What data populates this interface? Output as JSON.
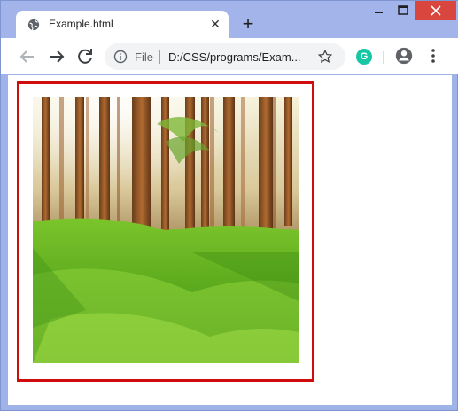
{
  "browser": {
    "tab": {
      "title": "Example.html",
      "favicon_icon": "globe-icon",
      "close_icon": "close-icon"
    },
    "new_tab_icon": "plus-icon",
    "window_controls": [
      "minimize-icon",
      "maximize-icon",
      "close-icon"
    ],
    "toolbar": {
      "back_icon": "back-arrow-icon",
      "forward_icon": "forward-arrow-icon",
      "reload_icon": "reload-icon",
      "omnibox": {
        "scheme_label": "File",
        "url": "D:/CSS/programs/Exam..."
      },
      "extension_label": "G",
      "account_icon": "account-icon",
      "menu_icon": "kebab-menu-icon"
    }
  },
  "page": {
    "image": {
      "subject": "forest-image",
      "border_color": "#d10c0c"
    }
  }
}
